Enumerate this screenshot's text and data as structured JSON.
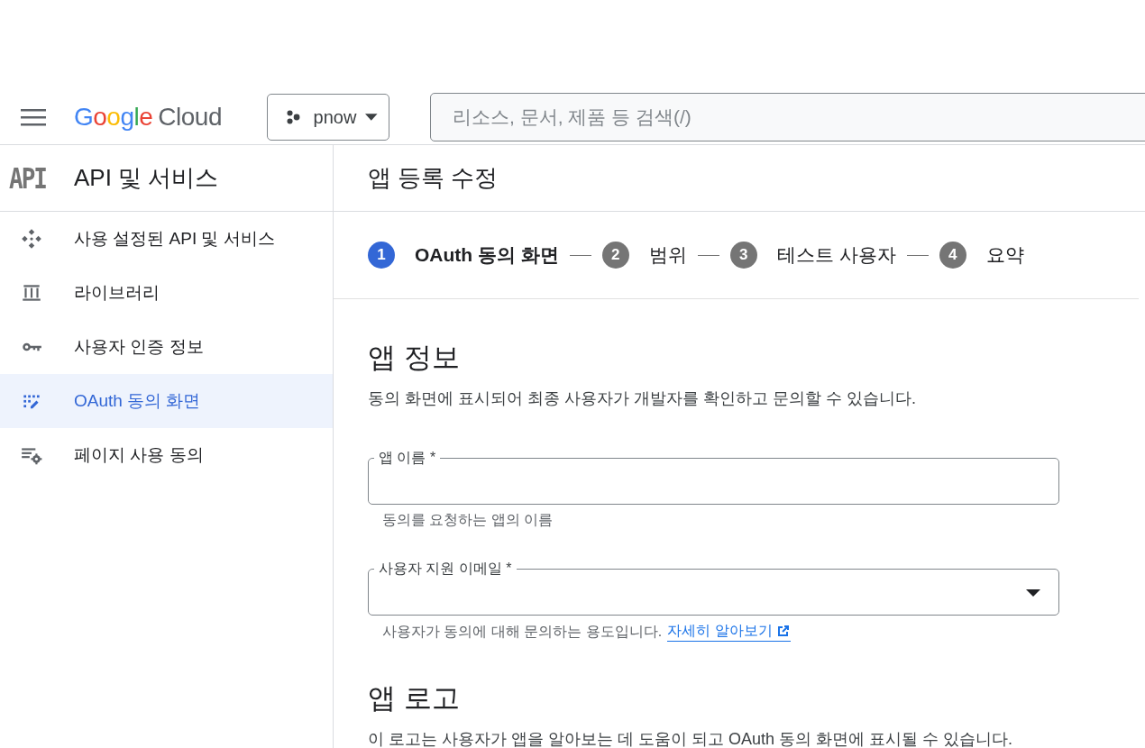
{
  "header": {
    "logo": {
      "brand": "Google",
      "product": "Cloud"
    },
    "project_picker": {
      "label": "pnow"
    },
    "search": {
      "placeholder": "리소스, 문서, 제품 등 검색(/)"
    }
  },
  "sidebar": {
    "badge": "API",
    "title": "API 및 서비스",
    "items": [
      {
        "label": "사용 설정된 API 및 서비스",
        "kind": "apis",
        "selected": false
      },
      {
        "label": "라이브러리",
        "kind": "library",
        "selected": false
      },
      {
        "label": "사용자 인증 정보",
        "kind": "credentials",
        "selected": false
      },
      {
        "label": "OAuth 동의 화면",
        "kind": "consent",
        "selected": true
      },
      {
        "label": "페이지 사용 동의",
        "kind": "agreements",
        "selected": false
      }
    ]
  },
  "main": {
    "title": "앱 등록 수정",
    "steps": [
      {
        "number": "1",
        "label": "OAuth 동의 화면",
        "selected": true
      },
      {
        "number": "2",
        "label": "범위",
        "selected": false
      },
      {
        "number": "3",
        "label": "테스트 사용자",
        "selected": false
      },
      {
        "number": "4",
        "label": "요약",
        "selected": false
      }
    ],
    "sections": [
      {
        "heading": "앱 정보",
        "description": "동의 화면에 표시되어 최종 사용자가 개발자를 확인하고 문의할 수 있습니다.",
        "fields": [
          {
            "kind": "text",
            "label": "앱 이름 *",
            "helper": "동의를 요청하는 앱의 이름"
          },
          {
            "kind": "select",
            "label": "사용자 지원 이메일 *",
            "helper": "사용자가 동의에 대해 문의하는 용도입니다.",
            "link": "자세히 알아보기"
          }
        ]
      },
      {
        "heading": "앱 로고",
        "description": "이 로고는 사용자가 앱을 알아보는 데 도움이 되고 OAuth 동의 화면에 표시될 수 있습니다."
      }
    ]
  }
}
